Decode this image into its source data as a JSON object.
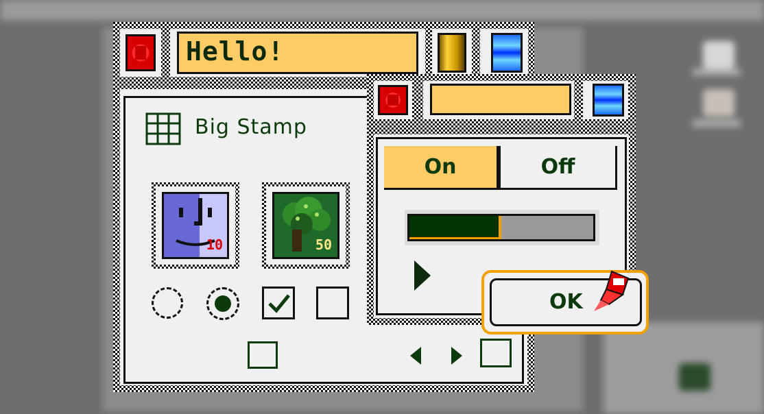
{
  "window_main": {
    "title": "Hello!",
    "stamp_title": "Big Stamp",
    "stamps": [
      {
        "name": "finder",
        "value_label": "10"
      },
      {
        "name": "tree",
        "value_label": "50"
      }
    ],
    "controls": {
      "radio_1_selected": false,
      "radio_2_selected": true,
      "checkbox_1_checked": true,
      "checkbox_2_checked": false
    }
  },
  "window_child": {
    "title": "",
    "segmented": {
      "on_label": "On",
      "off_label": "Off",
      "selected": "On"
    },
    "progress": 0.5,
    "ok_label": "OK"
  },
  "colors": {
    "title_fill": "#ffcc66",
    "text_dark": "#0d3a0d",
    "accent_orange": "#f0a000",
    "progress_fill": "#003300"
  },
  "icons": [
    "close-icon",
    "grid-icon",
    "finder-icon",
    "tree-stamp-icon",
    "play-icon",
    "pen-cursor-icon",
    "left-arrow-icon",
    "right-arrow-icon"
  ]
}
